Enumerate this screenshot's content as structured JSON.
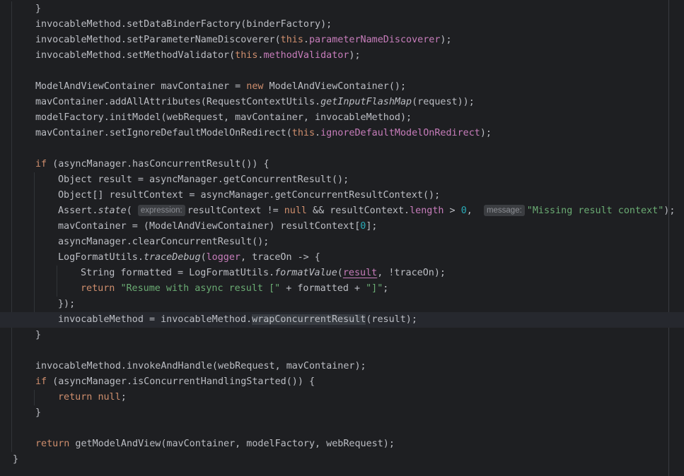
{
  "editor": {
    "lines": [
      {
        "indent": 1,
        "tokens": [
          {
            "t": "}"
          }
        ]
      },
      {
        "indent": 1,
        "tokens": [
          {
            "t": "invocableMethod.setDataBinderFactory(binderFactory);"
          }
        ]
      },
      {
        "indent": 1,
        "tokens": [
          {
            "t": "invocableMethod.setParameterNameDiscoverer("
          },
          {
            "t": "this",
            "c": "kw"
          },
          {
            "t": "."
          },
          {
            "t": "parameterNameDiscoverer",
            "c": "fld"
          },
          {
            "t": ");"
          }
        ]
      },
      {
        "indent": 1,
        "tokens": [
          {
            "t": "invocableMethod.setMethodValidator("
          },
          {
            "t": "this",
            "c": "kw"
          },
          {
            "t": "."
          },
          {
            "t": "methodValidator",
            "c": "fld"
          },
          {
            "t": ");"
          }
        ]
      },
      {
        "indent": 1,
        "tokens": []
      },
      {
        "indent": 1,
        "tokens": [
          {
            "t": "ModelAndViewContainer mavContainer = "
          },
          {
            "t": "new",
            "c": "kw"
          },
          {
            "t": " ModelAndViewContainer();"
          }
        ]
      },
      {
        "indent": 1,
        "tokens": [
          {
            "t": "mavContainer.addAllAttributes(RequestContextUtils."
          },
          {
            "t": "getInputFlashMap",
            "c": "it"
          },
          {
            "t": "(request));"
          }
        ]
      },
      {
        "indent": 1,
        "tokens": [
          {
            "t": "modelFactory.initModel(webRequest, mavContainer, invocableMethod);"
          }
        ]
      },
      {
        "indent": 1,
        "tokens": [
          {
            "t": "mavContainer.setIgnoreDefaultModelOnRedirect("
          },
          {
            "t": "this",
            "c": "kw"
          },
          {
            "t": "."
          },
          {
            "t": "ignoreDefaultModelOnRedirect",
            "c": "fld"
          },
          {
            "t": ");"
          }
        ]
      },
      {
        "indent": 1,
        "tokens": []
      },
      {
        "indent": 1,
        "tokens": [
          {
            "t": "if",
            "c": "kw"
          },
          {
            "t": " (asyncManager.hasConcurrentResult()) {"
          }
        ]
      },
      {
        "indent": 2,
        "tokens": [
          {
            "t": "Object result = asyncManager.getConcurrentResult();"
          }
        ]
      },
      {
        "indent": 2,
        "tokens": [
          {
            "t": "Object[] resultContext = asyncManager.getConcurrentResultContext();"
          }
        ]
      },
      {
        "indent": 2,
        "tokens": [
          {
            "t": "Assert."
          },
          {
            "t": "state",
            "c": "it"
          },
          {
            "t": "( "
          },
          {
            "t": "expression:",
            "c": "hint"
          },
          {
            "t": "resultContext != "
          },
          {
            "t": "null",
            "c": "kw"
          },
          {
            "t": " && resultContext."
          },
          {
            "t": "length",
            "c": "fld"
          },
          {
            "t": " > "
          },
          {
            "t": "0",
            "c": "num"
          },
          {
            "t": ",  "
          },
          {
            "t": "message:",
            "c": "hint"
          },
          {
            "t": "\"Missing result context\"",
            "c": "str"
          },
          {
            "t": ");"
          }
        ]
      },
      {
        "indent": 2,
        "tokens": [
          {
            "t": "mavContainer = (ModelAndViewContainer) resultContext["
          },
          {
            "t": "0",
            "c": "num"
          },
          {
            "t": "];"
          }
        ]
      },
      {
        "indent": 2,
        "tokens": [
          {
            "t": "asyncManager.clearConcurrentResult();"
          }
        ]
      },
      {
        "indent": 2,
        "tokens": [
          {
            "t": "LogFormatUtils."
          },
          {
            "t": "traceDebug",
            "c": "it"
          },
          {
            "t": "("
          },
          {
            "t": "logger",
            "c": "fld"
          },
          {
            "t": ", traceOn -> {"
          }
        ]
      },
      {
        "indent": 3,
        "tokens": [
          {
            "t": "String formatted = LogFormatUtils."
          },
          {
            "t": "formatValue",
            "c": "it"
          },
          {
            "t": "("
          },
          {
            "t": "result",
            "c": "fld warn-underline"
          },
          {
            "t": ", !traceOn);"
          }
        ]
      },
      {
        "indent": 3,
        "tokens": [
          {
            "t": "return",
            "c": "kw"
          },
          {
            "t": " "
          },
          {
            "t": "\"Resume with async result [\"",
            "c": "str"
          },
          {
            "t": " + formatted + "
          },
          {
            "t": "\"]\"",
            "c": "str"
          },
          {
            "t": ";"
          }
        ]
      },
      {
        "indent": 2,
        "tokens": [
          {
            "t": "});"
          }
        ]
      },
      {
        "indent": 2,
        "current": true,
        "tokens": [
          {
            "t": "invocableMethod = invocableMethod."
          },
          {
            "t": "wrapConcurrentResult",
            "c": "highlight-word"
          },
          {
            "t": "(result);"
          }
        ]
      },
      {
        "indent": 1,
        "tokens": [
          {
            "t": "}"
          }
        ]
      },
      {
        "indent": 1,
        "tokens": []
      },
      {
        "indent": 1,
        "tokens": [
          {
            "t": "invocableMethod.invokeAndHandle(webRequest, mavContainer);"
          }
        ]
      },
      {
        "indent": 1,
        "tokens": [
          {
            "t": "if",
            "c": "kw"
          },
          {
            "t": " (asyncManager.isConcurrentHandlingStarted()) {"
          }
        ]
      },
      {
        "indent": 2,
        "tokens": [
          {
            "t": "return",
            "c": "kw"
          },
          {
            "t": " "
          },
          {
            "t": "null",
            "c": "kw"
          },
          {
            "t": ";"
          }
        ]
      },
      {
        "indent": 1,
        "tokens": [
          {
            "t": "}"
          }
        ]
      },
      {
        "indent": 1,
        "tokens": []
      },
      {
        "indent": 1,
        "tokens": [
          {
            "t": "return",
            "c": "kw"
          },
          {
            "t": " getModelAndView(mavContainer, modelFactory, webRequest);"
          }
        ]
      },
      {
        "indent": 0,
        "tokens": [
          {
            "t": "}"
          }
        ]
      }
    ]
  }
}
